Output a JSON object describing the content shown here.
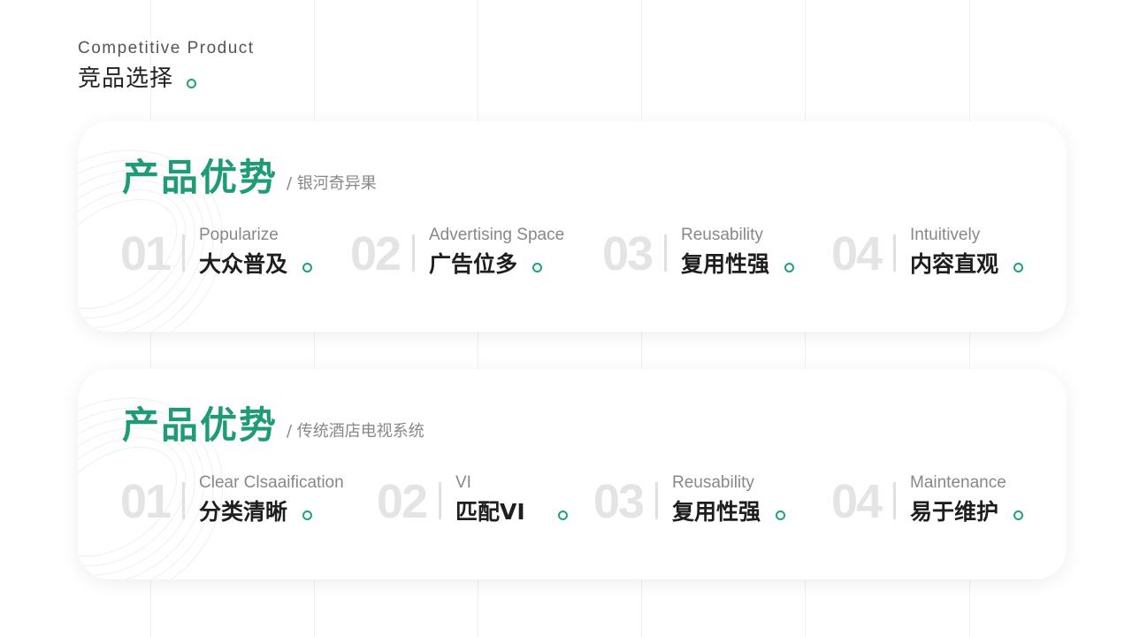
{
  "header": {
    "subtitle_en": "Competitive Product",
    "title_cn": "竞品选择"
  },
  "cards": [
    {
      "title": "产品优势",
      "subtitle": "/ 银河奇异果",
      "items": [
        {
          "num": "01",
          "en": "Popularize",
          "cn": "大众普及"
        },
        {
          "num": "02",
          "en": "Advertising Space",
          "cn": "广告位多"
        },
        {
          "num": "03",
          "en": "Reusability",
          "cn": "复用性强"
        },
        {
          "num": "04",
          "en": "Intuitively",
          "cn": "内容直观"
        }
      ]
    },
    {
      "title": "产品优势",
      "subtitle": "/ 传统酒店电视系统",
      "items": [
        {
          "num": "01",
          "en": "Clear Clsaaification",
          "cn": "分类清晰"
        },
        {
          "num": "02",
          "en": "VI",
          "cn": "匹配VI"
        },
        {
          "num": "03",
          "en": "Reusability",
          "cn": "复用性强"
        },
        {
          "num": "04",
          "en": "Maintenance",
          "cn": "易于维护"
        }
      ]
    }
  ],
  "colors": {
    "accent": "#1f9c77",
    "number_gray": "#e4e4e4",
    "text_dark": "#1e1e1e",
    "text_muted": "#888888"
  }
}
